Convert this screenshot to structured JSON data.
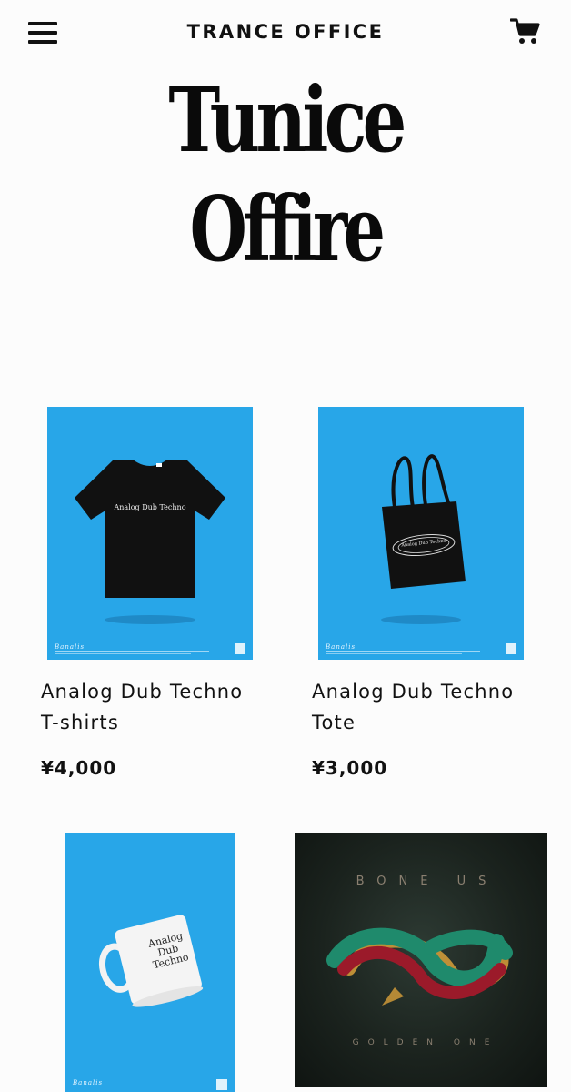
{
  "header": {
    "store_title": "TRANCE OFFICE",
    "logo_line1": "Tunice",
    "logo_line2": "Offire"
  },
  "products": [
    {
      "name_line1": "Analog Dub Techno",
      "name_line2": "T-shirts",
      "price": "¥4,000",
      "print_text": "Analog Dub Techno",
      "poster_brand": "Banalis",
      "icon": "t-shirt"
    },
    {
      "name_line1": "Analog Dub Techno",
      "name_line2": "Tote",
      "price": "¥3,000",
      "print_text": "Analog Dub Techno",
      "poster_brand": "Banalis",
      "icon": "tote-bag"
    },
    {
      "print_text_1": "Analog",
      "print_text_2": "Dub",
      "print_text_3": "Techno",
      "poster_brand": "Banalis",
      "icon": "mug"
    },
    {
      "album_artist": "BONE US",
      "album_title": "GOLDEN ONE",
      "icon": "album-cover"
    }
  ],
  "colors": {
    "poster_blue": "#28a6e8",
    "album_dark": "#172019",
    "text": "#111111"
  }
}
